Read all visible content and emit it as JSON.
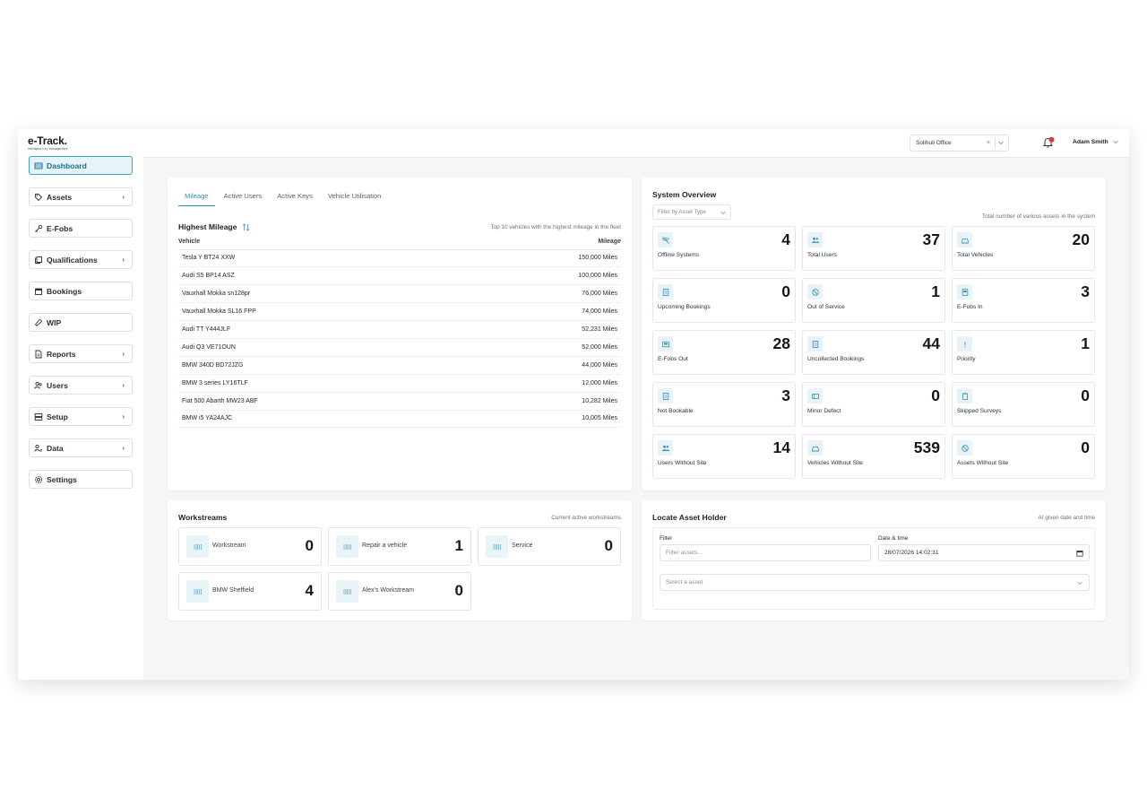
{
  "brand": {
    "name": "e-Track.",
    "tagline": "Intelligent Key Management"
  },
  "sidebar": {
    "items": [
      {
        "label": "Dashboard",
        "icon": "dashboard-icon",
        "active": true,
        "chevron": false
      },
      {
        "label": "Assets",
        "icon": "tag-icon",
        "chevron": true
      },
      {
        "label": "E-Fobs",
        "icon": "key-icon",
        "chevron": false
      },
      {
        "label": "Qualifications",
        "icon": "copy-icon",
        "chevron": true
      },
      {
        "label": "Bookings",
        "icon": "calendar-icon",
        "chevron": false
      },
      {
        "label": "WIP",
        "icon": "wrench-icon",
        "chevron": false
      },
      {
        "label": "Reports",
        "icon": "document-icon",
        "chevron": true
      },
      {
        "label": "Users",
        "icon": "users-icon",
        "chevron": true
      },
      {
        "label": "Setup",
        "icon": "server-icon",
        "chevron": true
      },
      {
        "label": "Data",
        "icon": "users-data-icon",
        "chevron": true
      },
      {
        "label": "Settings",
        "icon": "gear-icon",
        "chevron": false
      }
    ]
  },
  "header": {
    "office": "Solihull Office",
    "clear": "×",
    "user": "Adam Smith"
  },
  "mileage": {
    "tabs": [
      "Mileage",
      "Active Users",
      "Active Keys",
      "Vehicle Utilisation"
    ],
    "title": "Highest Mileage",
    "subtitle": "Top 10 vehicles with the highest mileage in the fleet",
    "columns": [
      "Vehicle",
      "Mileage"
    ],
    "rows": [
      [
        "Tesla Y BT24 XXW",
        "150,000 Miles"
      ],
      [
        "Audi S5 BP14 ASZ",
        "100,000 Miles"
      ],
      [
        "Vauxhall Mokka sn128pr",
        "76,000 Miles"
      ],
      [
        "Vauxhall Mokka SL16 FPP",
        "74,000 Miles"
      ],
      [
        "Audi TT Y444JLF",
        "52,231 Miles"
      ],
      [
        "Audi Q3 VE71OUN",
        "52,000 Miles"
      ],
      [
        "BMW 340D BD72JZG",
        "44,000 Miles"
      ],
      [
        "BMW 3 series LY16TLF",
        "12,000 Miles"
      ],
      [
        "Fiat 500 Abarth MW23 ABF",
        "10,282 Miles"
      ],
      [
        "BMW i5 YA24AJC",
        "10,005 Miles"
      ]
    ]
  },
  "overview": {
    "title": "System Overview",
    "filter_placeholder": "Filter by Asset Type",
    "subtitle": "Total number of various assets in the system",
    "stats": [
      {
        "label": "Offline Systems",
        "value": "4",
        "icon": "wifi-off-icon"
      },
      {
        "label": "Total Users",
        "value": "37",
        "icon": "users-icon"
      },
      {
        "label": "Total Vehicles",
        "value": "20",
        "icon": "car-icon"
      },
      {
        "label": "Upcoming Bookings",
        "value": "0",
        "icon": "booking-icon"
      },
      {
        "label": "Out of Service",
        "value": "1",
        "icon": "ban-icon"
      },
      {
        "label": "E-Fobs In",
        "value": "3",
        "icon": "fob-in-icon"
      },
      {
        "label": "E-Fobs Out",
        "value": "28",
        "icon": "fob-out-icon"
      },
      {
        "label": "Uncollected Bookings",
        "value": "44",
        "icon": "booking-icon"
      },
      {
        "label": "Priority",
        "value": "1",
        "icon": "exclamation-icon"
      },
      {
        "label": "Not Bookable",
        "value": "3",
        "icon": "booking-icon"
      },
      {
        "label": "Minor Defect",
        "value": "0",
        "icon": "defect-icon"
      },
      {
        "label": "Skipped Surveys",
        "value": "0",
        "icon": "clipboard-icon"
      },
      {
        "label": "Users Without Site",
        "value": "14",
        "icon": "users-icon"
      },
      {
        "label": "Vehicles Without Site",
        "value": "539",
        "icon": "car-icon"
      },
      {
        "label": "Assets Without Site",
        "value": "0",
        "icon": "ban-icon"
      }
    ]
  },
  "workstreams": {
    "title": "Workstreams",
    "subtitle": "Current active workstreams",
    "items": [
      {
        "label": "Workstream",
        "value": "0"
      },
      {
        "label": "Repair a vehicle",
        "value": "1"
      },
      {
        "label": "Service",
        "value": "0"
      },
      {
        "label": "BMW Sheffield",
        "value": "4"
      },
      {
        "label": "Alex's Workstream",
        "value": "0"
      }
    ]
  },
  "locate": {
    "title": "Locate Asset Holder",
    "subtitle": "At given date and time",
    "filter_label": "Filter",
    "filter_placeholder": "Filter assets...",
    "date_label": "Date & time",
    "date_value": "28/07/2026 14:02:31",
    "select_placeholder": "Select a asset"
  },
  "colors": {
    "accent": "#2b91b8",
    "background": "#f4f6f8",
    "badge": "#e53935"
  }
}
